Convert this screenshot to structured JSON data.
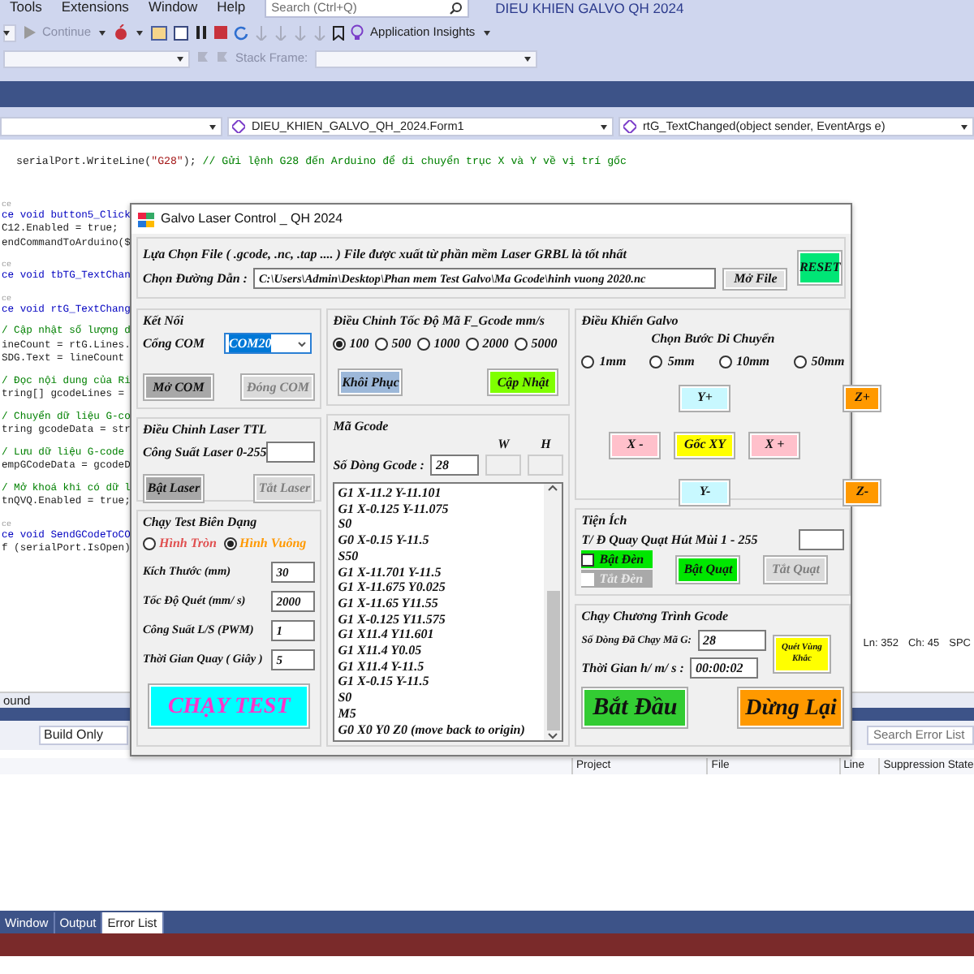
{
  "ide": {
    "menu": [
      "Tools",
      "Extensions",
      "Window",
      "Help"
    ],
    "search_placeholder": "Search (Ctrl+Q)",
    "title": "DIEU KHIEN GALVO QH 2024",
    "continue": "Continue",
    "app_insights": "Application Insights",
    "stack_frame": "Stack Frame:",
    "nav": [
      "DIEU_KHIEN_GALVO_QH_2024.Form1",
      "rtG_TextChanged(object sender, EventArgs e)"
    ],
    "code_top": [
      {
        "kind": "plain",
        "text": "serialPort.WriteLine("
      },
      {
        "kind": "string",
        "text": "\"G28\""
      },
      {
        "kind": "plain",
        "text": "); "
      },
      {
        "kind": "comment",
        "text": "// Gửi lệnh G28 đến Arduino để di chuyển trục X và Y về vị trí gốc"
      }
    ],
    "code_lines": [
      {
        "kind": "lens",
        "text": "ce"
      },
      {
        "kind": "decl",
        "text": "ce void button5_Click"
      },
      {
        "kind": "code",
        "text": "C12.Enabled = true;"
      },
      {
        "kind": "code",
        "text": "endCommandToArduino($"
      },
      {
        "kind": "lens",
        "text": "ce"
      },
      {
        "kind": "decl",
        "text": "ce void tbTG_TextChan"
      },
      {
        "kind": "lens",
        "text": "ce"
      },
      {
        "kind": "decl",
        "text": "ce void rtG_TextChang"
      },
      {
        "kind": "comment",
        "text": "/ Cập nhật số lượng d"
      },
      {
        "kind": "code",
        "text": "ineCount = rtG.Lines."
      },
      {
        "kind": "code",
        "text": "SDG.Text = lineCount"
      },
      {
        "kind": "comment",
        "text": "/ Đọc nội dung của Ri"
      },
      {
        "kind": "code",
        "text": "tring[] gcodeLines ="
      },
      {
        "kind": "comment",
        "text": "/ Chuyển dữ liệu G-co"
      },
      {
        "kind": "code",
        "text": "tring gcodeData = str"
      },
      {
        "kind": "comment",
        "text": "/ Lưu dữ liệu G-code"
      },
      {
        "kind": "code",
        "text": "empGCodeData = gcodeD"
      },
      {
        "kind": "comment",
        "text": "/ Mở khoá khi có dữ l"
      },
      {
        "kind": "code",
        "text": "tnQVQ.Enabled = true;"
      },
      {
        "kind": "lens",
        "text": "ce"
      },
      {
        "kind": "decl",
        "text": "ce void SendGCodeToCO"
      },
      {
        "kind": "code",
        "text": "f (serialPort.IsOpen)"
      }
    ],
    "status": [
      "Ln: 352",
      "Ch: 45",
      "SPC"
    ],
    "panel_title": "ound",
    "build_filter": "Build Only",
    "error_search": "Search Error List",
    "error_columns": [
      "Project",
      "File",
      "Line",
      "Suppression State"
    ],
    "bottom_tabs": [
      {
        "label": "Window",
        "selected": false
      },
      {
        "label": "Output",
        "selected": false
      },
      {
        "label": "Error List",
        "selected": true
      }
    ]
  },
  "form": {
    "title": "Galvo Laser Control _ QH 2024",
    "file": {
      "note": "Lựa Chọn File ( .gcode, .nc, .tap .... ) File được xuất từ phần mềm Laser GRBL là tốt nhất",
      "path_label": "Chọn Đường Dẫn :",
      "path": "C:\\Users\\Admin\\Desktop\\Phan mem Test Galvo\\Ma Gcode\\hinh vuong 2020.nc",
      "open_button": "Mở File",
      "reset_button": "RESET"
    },
    "connect": {
      "title": "Kết Nối",
      "port_label": "Cổng COM",
      "port": "COM20",
      "open": {
        "label": "Mở COM",
        "disabled": false
      },
      "close": {
        "label": "Đóng COM",
        "disabled": true
      }
    },
    "laser": {
      "title": "Điều Chỉnh Laser TTL",
      "power_label": "Công Suất Laser 0-255",
      "on": {
        "label": "Bật Laser",
        "disabled": false
      },
      "off": {
        "label": "Tắt Laser",
        "disabled": true
      }
    },
    "test": {
      "title": "Chạy Test Biên Dạng",
      "shapes": [
        {
          "label": "Hình Tròn",
          "selected": false,
          "color": "#e05050"
        },
        {
          "label": "Hình Vuông",
          "selected": true,
          "color": "#ff9900"
        }
      ],
      "fields": [
        {
          "label": "Kích Thước (mm)",
          "value": "30"
        },
        {
          "label": "Tốc Độ Quét (mm/ s)",
          "value": "2000"
        },
        {
          "label": "Công Suất L/S (PWM)",
          "value": "1"
        },
        {
          "label": "Thời Gian Quay ( Giây )",
          "value": "5"
        }
      ],
      "run_button": "CHẠY TEST"
    },
    "speed": {
      "title": "Điều Chỉnh Tốc Độ Mã F_Gcode mm/s",
      "options": [
        {
          "label": "100",
          "selected": true
        },
        {
          "label": "500",
          "selected": false
        },
        {
          "label": "1000",
          "selected": false
        },
        {
          "label": "2000",
          "selected": false
        },
        {
          "label": "5000",
          "selected": false
        }
      ],
      "restore_button": "Khôi Phục",
      "update_button": "Cập Nhật"
    },
    "gcode": {
      "title": "Mã Gcode",
      "count_label": "Số Dòng Gcode :",
      "count": "28",
      "w_label": "W",
      "h_label": "H",
      "lines": [
        "G1 X-11.2 Y-11.101",
        "G1 X-0.125 Y-11.075",
        "S0",
        "G0 X-0.15 Y-11.5",
        "S50",
        "G1 X-11.701 Y-11.5",
        "G1 X-11.675 Y0.025",
        "G1 X-11.65 Y11.55",
        "G1 X-0.125 Y11.575",
        "G1 X11.4 Y11.601",
        "G1 X11.4 Y0.05",
        "G1 X11.4 Y-11.5",
        "G1 X-0.15 Y-11.5",
        "S0",
        "M5",
        "G0 X0 Y0 Z0 (move back to origin)"
      ]
    },
    "galvo": {
      "title": "Điều Khiển Galvo",
      "step_title": "Chọn Bước Di Chuyển",
      "steps": [
        {
          "label": "1mm",
          "selected": false
        },
        {
          "label": "5mm",
          "selected": false
        },
        {
          "label": "10mm",
          "selected": false
        },
        {
          "label": "50mm",
          "selected": false
        }
      ],
      "jog": {
        "y_plus": {
          "label": "Y+",
          "color": "#c8f8ff"
        },
        "z_plus": {
          "label": "Z+",
          "color": "#ff9900"
        },
        "x_minus": {
          "label": "X -",
          "color": "#ffc0cb"
        },
        "home": {
          "label": "Gốc XY",
          "color": "#ffff00"
        },
        "x_plus": {
          "label": "X +",
          "color": "#ffc0cb"
        },
        "y_minus": {
          "label": "Y-",
          "color": "#c8f8ff"
        },
        "z_minus": {
          "label": "Z-",
          "color": "#ff9900"
        }
      }
    },
    "utility": {
      "title": "Tiện Ích",
      "fan_label": "T/ Đ Quay Quạt Hút Mùi 1 - 255",
      "light_on": {
        "label": "Bật Đèn",
        "checked": false,
        "disabled": false
      },
      "light_off": {
        "label": "Tắt Đèn",
        "checked": false,
        "disabled": true
      },
      "fan_on": {
        "label": "Bật Quạt",
        "disabled": false
      },
      "fan_off": {
        "label": "Tắt Quạt",
        "disabled": true
      }
    },
    "run": {
      "title": "Chạy Chương Trình Gcode",
      "lines_label": "Số Dòng Đã Chạy Mã G:",
      "lines": "28",
      "time_label": "Thời Gian h/ m/ s :",
      "time": "00:00:02",
      "sweep_button": "Quét Vùng Khắc",
      "start_button": "Bắt Đầu",
      "stop_button": "Dừng Lại"
    }
  }
}
